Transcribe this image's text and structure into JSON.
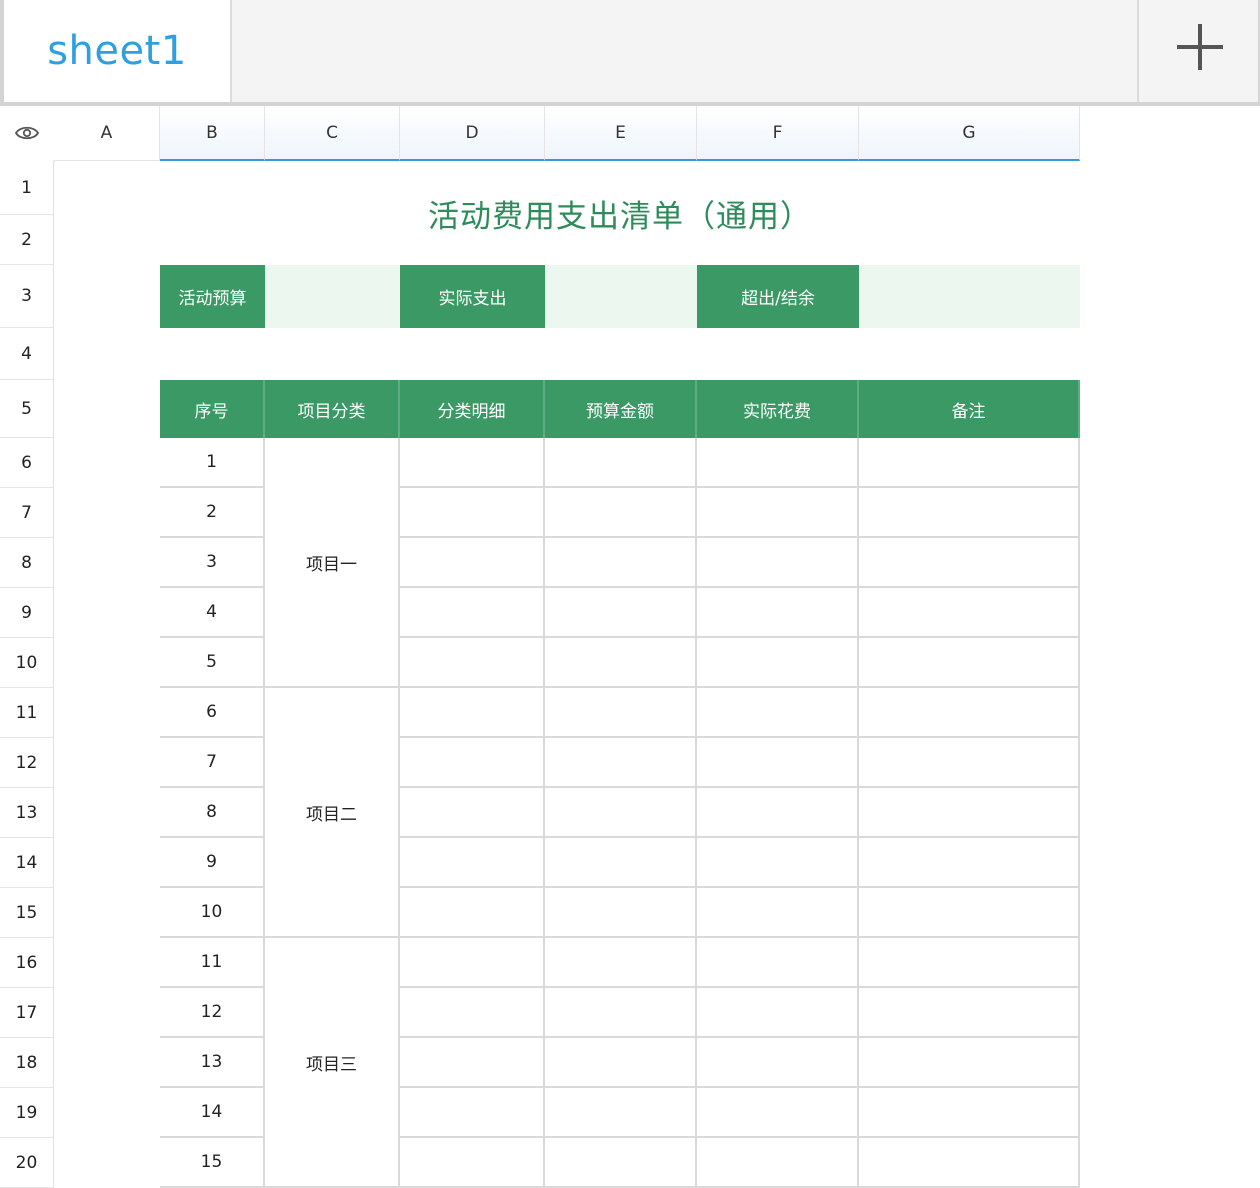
{
  "tabs": [
    {
      "label": "sheet1"
    }
  ],
  "add_sheet_icon": "plus-icon",
  "corner_icon": "eye-icon",
  "columns": [
    "A",
    "B",
    "C",
    "D",
    "E",
    "F",
    "G"
  ],
  "selected_columns": [
    "B",
    "C",
    "D",
    "E",
    "F",
    "G"
  ],
  "rows": [
    "1",
    "2",
    "3",
    "4",
    "5",
    "6",
    "7",
    "8",
    "9",
    "10",
    "11",
    "12",
    "13",
    "14",
    "15",
    "16",
    "17",
    "18",
    "19",
    "20"
  ],
  "sheet": {
    "title": "活动费用支出清单（通用）",
    "summary": {
      "budget_label": "活动预算",
      "budget_value": "",
      "actual_label": "实际支出",
      "actual_value": "",
      "diff_label": "超出/结余",
      "diff_value": ""
    },
    "headers": [
      "序号",
      "项目分类",
      "分类明细",
      "预算金额",
      "实际花费",
      "备注"
    ],
    "seq": [
      "1",
      "2",
      "3",
      "4",
      "5",
      "6",
      "7",
      "8",
      "9",
      "10",
      "11",
      "12",
      "13",
      "14",
      "15"
    ],
    "groups": [
      "项目一",
      "项目二",
      "项目三"
    ]
  },
  "colors": {
    "header_green": "#3a9964",
    "title_green": "#2e8b5a",
    "light_green": "#ecf7ef",
    "tab_blue": "#2f9fe0",
    "selection_blue": "#3a98d6"
  }
}
